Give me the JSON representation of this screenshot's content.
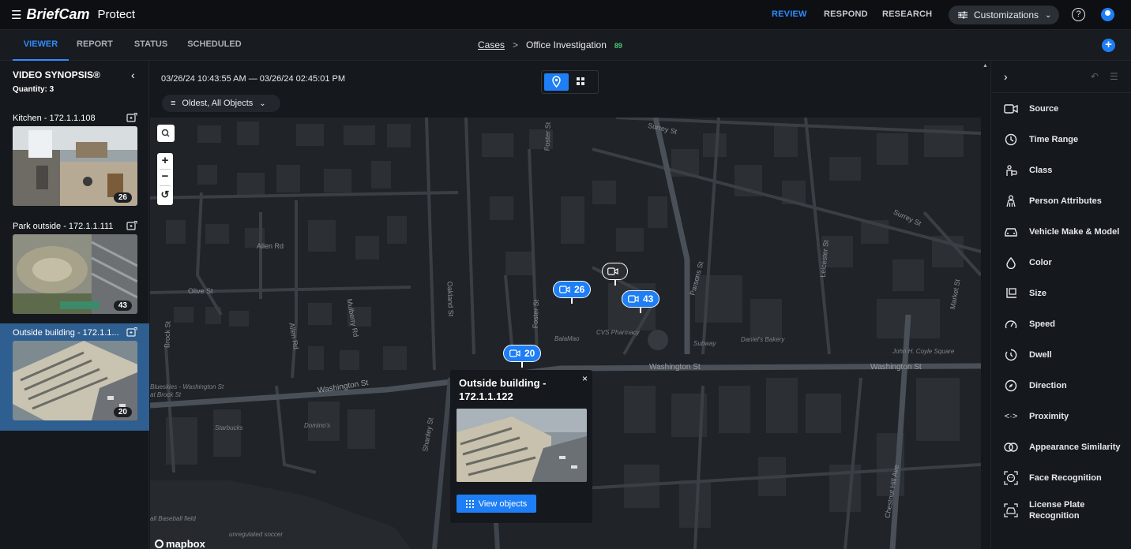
{
  "app": {
    "brand": "BriefCam",
    "product": "Protect"
  },
  "top_nav": {
    "review": "REVIEW",
    "respond": "RESPOND",
    "research": "RESEARCH",
    "customizations": "Customizations",
    "active": "REVIEW"
  },
  "colors": {
    "accent": "#1e7ef5",
    "active_row": "#2f5f91",
    "count_green": "#4cc96b"
  },
  "tabs": [
    {
      "label": "VIEWER",
      "active": true
    },
    {
      "label": "REPORT",
      "active": false
    },
    {
      "label": "STATUS",
      "active": false
    },
    {
      "label": "SCHEDULED",
      "active": false
    }
  ],
  "breadcrumb": {
    "cases": "Cases",
    "separator": ">",
    "current": "Office Investigation",
    "count": "89"
  },
  "sidebar": {
    "title": "VIDEO SYNOPSIS®",
    "quantity": "Quantity: 3",
    "cameras": [
      {
        "label": "Kitchen - 172.1.1.108",
        "count": "26",
        "active": false
      },
      {
        "label": "Park outside - 172.1.1.111",
        "count": "43",
        "active": false
      },
      {
        "label": "Outside building - 172.1.1...",
        "count": "20",
        "active": true
      }
    ]
  },
  "map": {
    "date_range": "03/26/24 10:43:55 AM — 03/26/24 02:45:01 PM",
    "sort": "Oldest, All Objects",
    "view_mode": "map",
    "streets": [
      "Surrey St",
      "Surrey St",
      "Foster St",
      "Allen Rd",
      "Olive St",
      "Oakland St",
      "Mulberry Rd",
      "Allen Rd",
      "Brock St",
      "Foster St",
      "Parsons St",
      "Leicester St",
      "Market St",
      "Washington St",
      "Washington St",
      "Washington St",
      "Shanley St",
      "Chestnut Hill Ave"
    ],
    "places": [
      "BalaMao",
      "CVS Pharmacy",
      "Subway",
      "Daniel's Bakery",
      "John H. Coyle Square",
      "Blueskies - Washington St at Brock St",
      "Starbucks",
      "Domino's",
      "all Baseball field",
      "unregulated soccer"
    ],
    "pins": [
      {
        "count": "26"
      },
      {
        "count": "43"
      },
      {
        "count": "20"
      },
      {
        "count": ""
      }
    ],
    "popup": {
      "title": "Outside building - 172.1.1.122",
      "close": "×",
      "button": "View objects"
    },
    "attribution": "mapbox"
  },
  "filters": [
    {
      "label": "Source",
      "icon": "camera-icon"
    },
    {
      "label": "Time Range",
      "icon": "clock-icon"
    },
    {
      "label": "Class",
      "icon": "class-icon"
    },
    {
      "label": "Person Attributes",
      "icon": "person-attributes-icon"
    },
    {
      "label": "Vehicle Make & Model",
      "icon": "car-icon"
    },
    {
      "label": "Color",
      "icon": "drop-icon"
    },
    {
      "label": "Size",
      "icon": "size-icon"
    },
    {
      "label": "Speed",
      "icon": "speed-icon"
    },
    {
      "label": "Dwell",
      "icon": "dwell-icon"
    },
    {
      "label": "Direction",
      "icon": "compass-icon"
    },
    {
      "label": "Proximity",
      "icon": "proximity-icon"
    },
    {
      "label": "Appearance Similarity",
      "icon": "similarity-icon"
    },
    {
      "label": "Face Recognition",
      "icon": "face-icon"
    },
    {
      "label": "License Plate Recognition",
      "icon": "plate-icon"
    }
  ]
}
